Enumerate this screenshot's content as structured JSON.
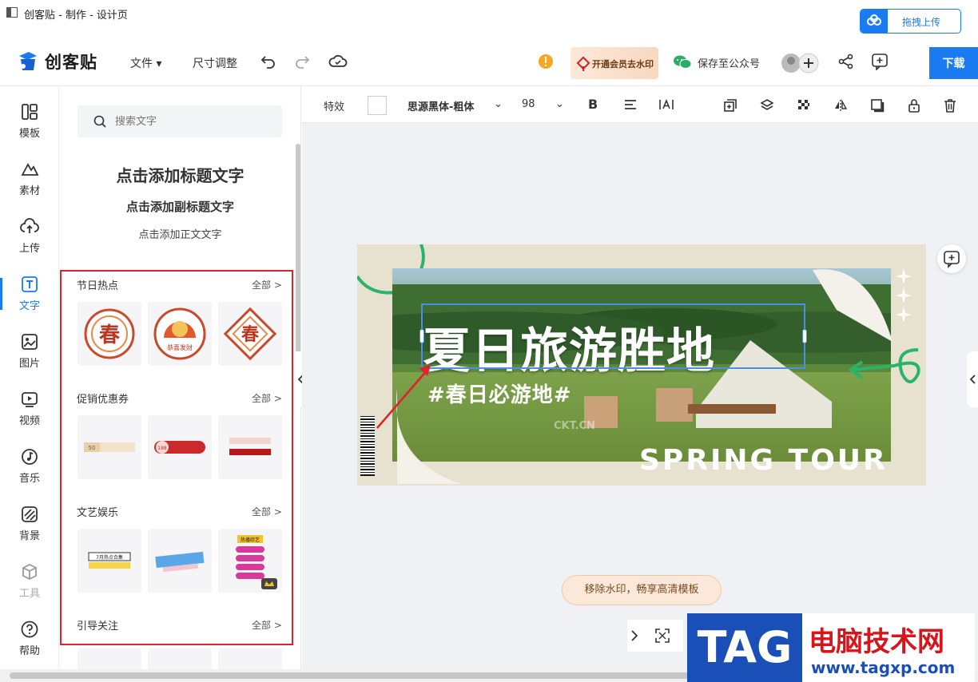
{
  "window": {
    "title": "创客贴 - 制作 - 设计页"
  },
  "cloud_upload": {
    "label": "拖拽上传"
  },
  "header": {
    "logo_text": "创客贴",
    "menu": {
      "file": "文件",
      "resize": "尺寸调整"
    },
    "vip_label": "开通会员去水印",
    "save_wechat": "保存至公众号",
    "download": "下载"
  },
  "rail": {
    "items": [
      {
        "label": "模板",
        "icon": "template-icon"
      },
      {
        "label": "素材",
        "icon": "shapes-icon"
      },
      {
        "label": "上传",
        "icon": "cloud-upload-icon"
      },
      {
        "label": "文字",
        "icon": "text-icon"
      },
      {
        "label": "图片",
        "icon": "image-icon"
      },
      {
        "label": "视频",
        "icon": "video-icon"
      },
      {
        "label": "音乐",
        "icon": "music-icon"
      },
      {
        "label": "背景",
        "icon": "background-icon"
      },
      {
        "label": "工具",
        "icon": "toolbox-icon"
      },
      {
        "label": "帮助",
        "icon": "help-icon"
      }
    ]
  },
  "panel": {
    "search_placeholder": "搜索文字",
    "add_title": "点击添加标题文字",
    "add_subtitle": "点击添加副标题文字",
    "add_body": "点击添加正文文字",
    "sections": [
      {
        "title": "节日热点",
        "all": "全部 >"
      },
      {
        "title": "促销优惠券",
        "all": "全部 >"
      },
      {
        "title": "文艺娱乐",
        "all": "全部 >"
      },
      {
        "title": "引导关注",
        "all": "全部 >"
      }
    ],
    "thumb_text": {
      "chun": "春",
      "gongxi": "恭喜发财",
      "coupon1": "50",
      "coupon2": "188",
      "july": "7月热点合集",
      "spring_rec": "热播综艺"
    }
  },
  "textbar": {
    "effects": "特效",
    "font": "思源黑体-粗体",
    "size": "98",
    "bold": "B"
  },
  "design": {
    "main_title": "夏日旅游胜地",
    "sub_title": "#春日必游地#",
    "english_title": "SPRING TOUR",
    "watermark": "CKT.CN"
  },
  "watermark_pill": "移除水印，畅享高清模板",
  "tag_logo": {
    "tag": "TAG",
    "cn": "电脑技术网",
    "url": "www.tagxp.com"
  },
  "colors": {
    "accent": "#1a7cf0",
    "highlight_border": "#e0202a",
    "canvas_bg": "#e7e2cf"
  }
}
